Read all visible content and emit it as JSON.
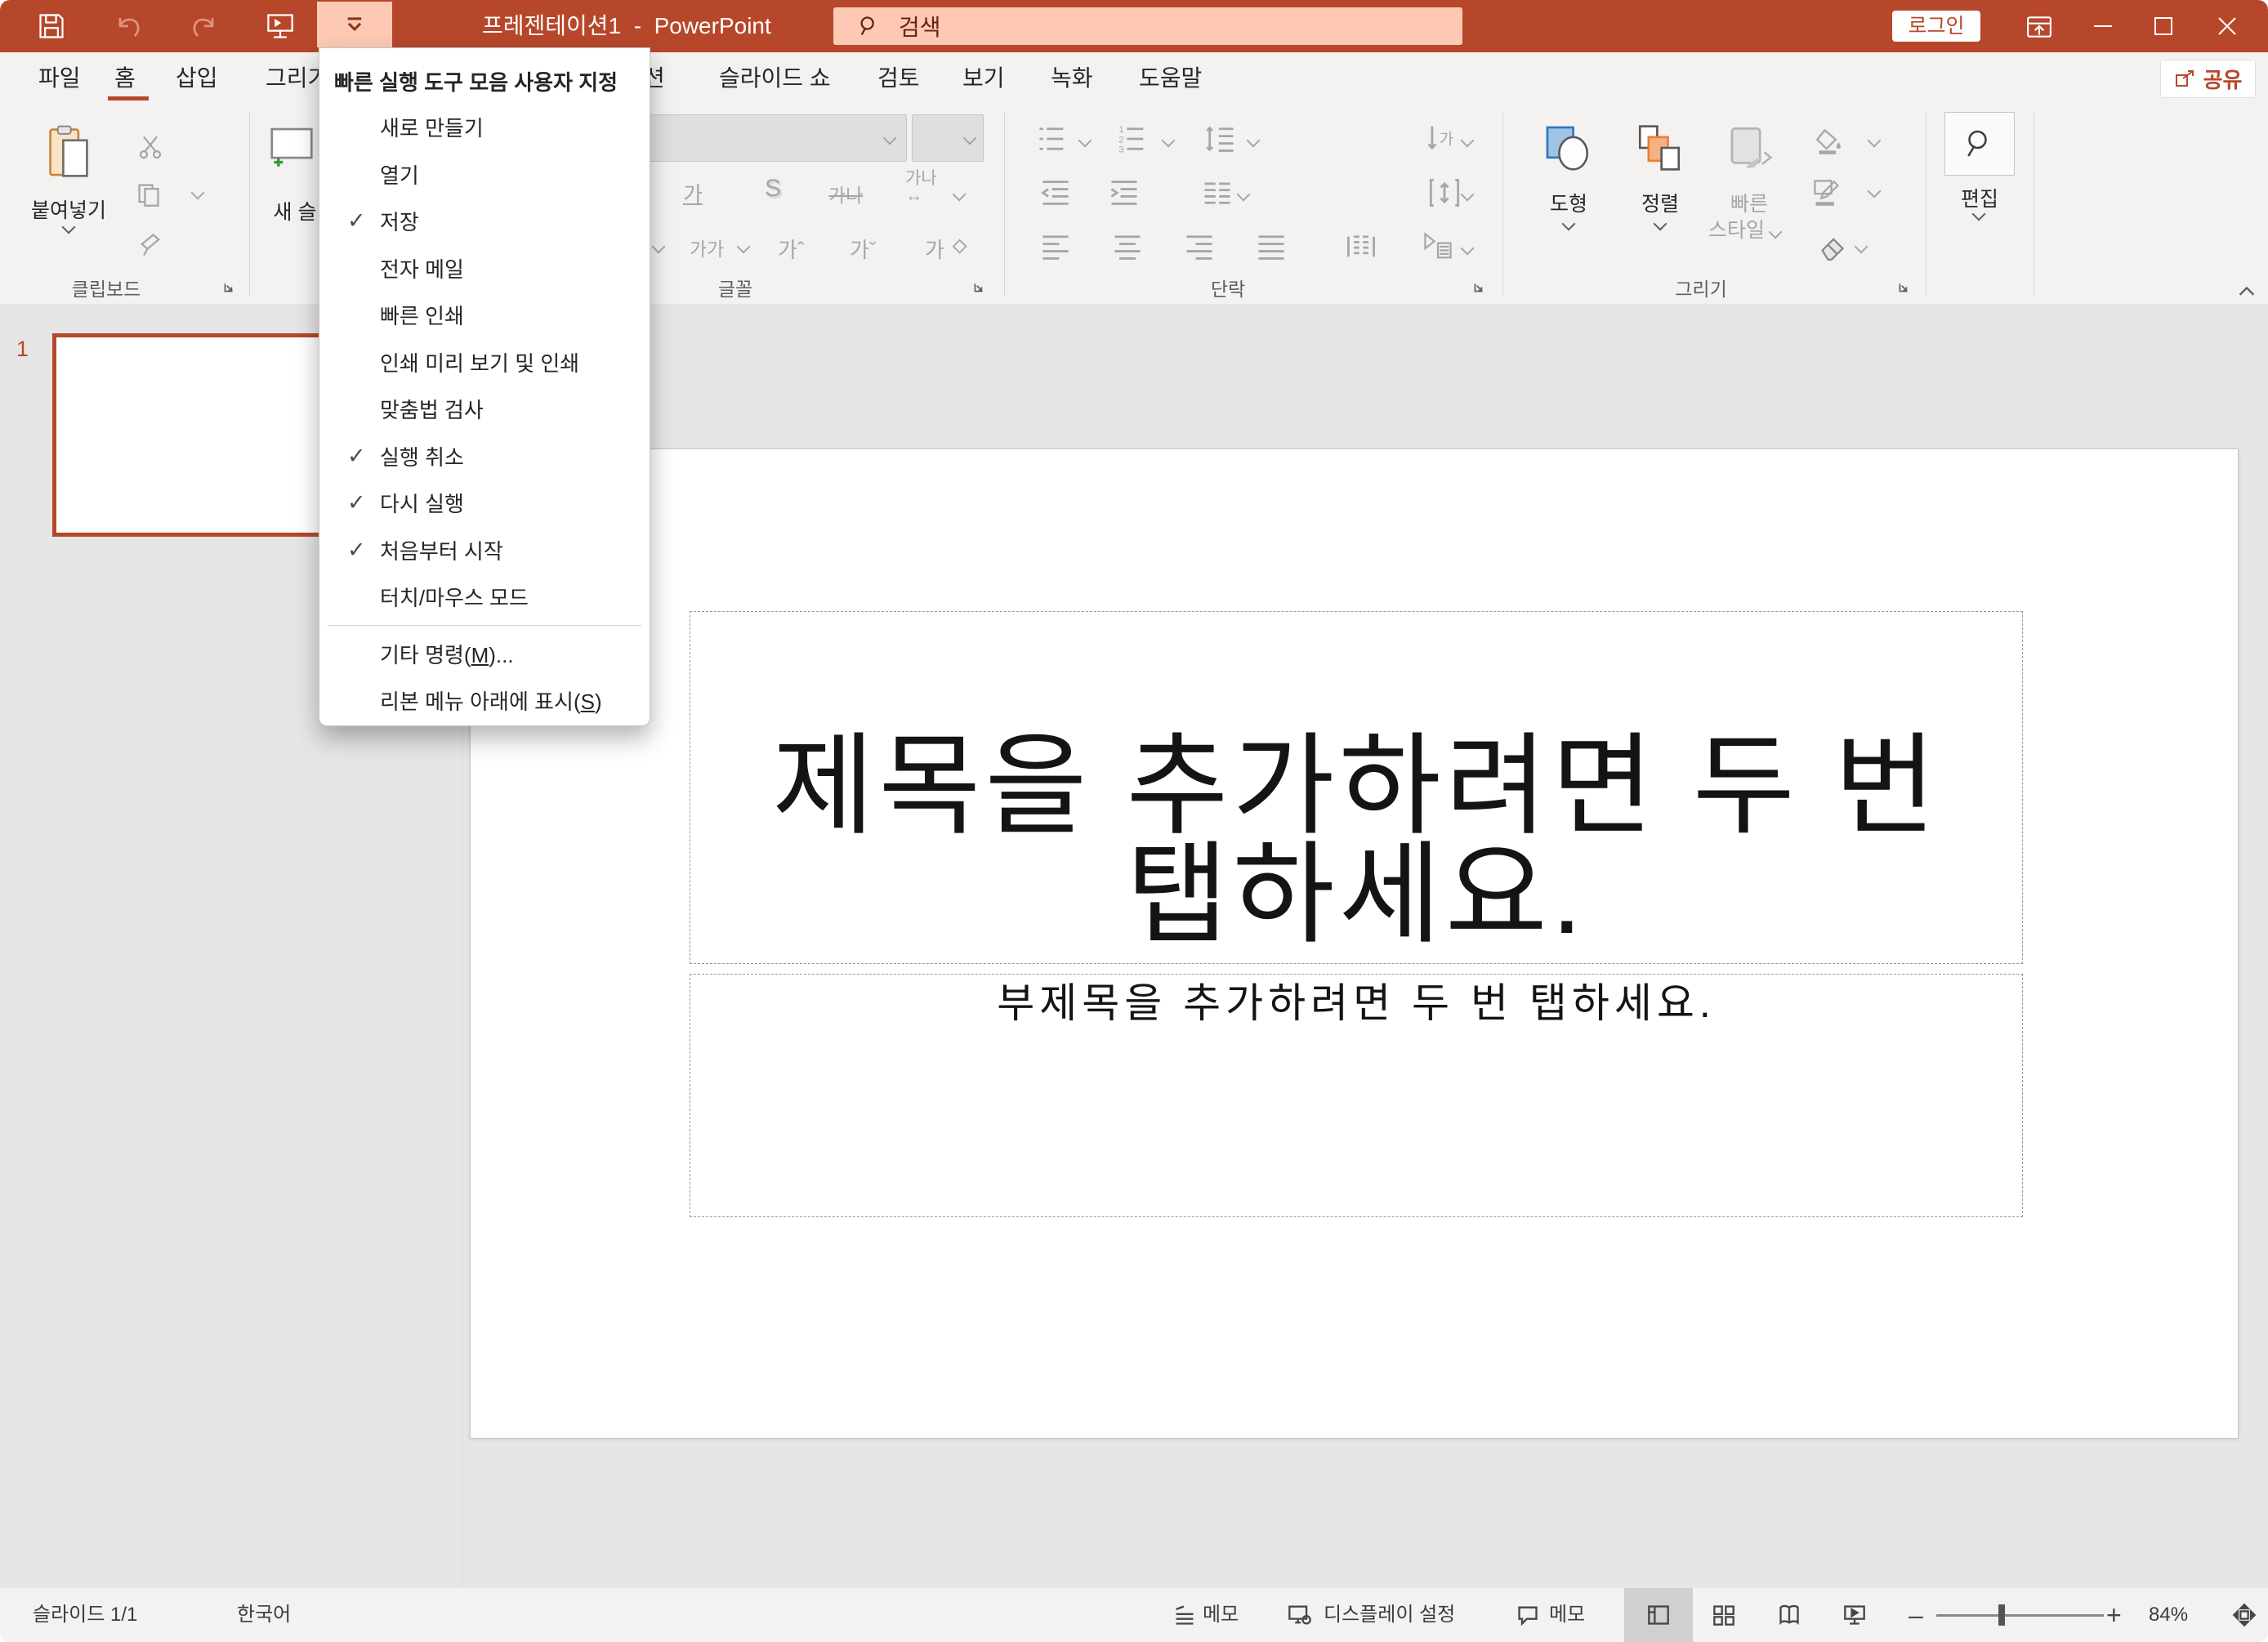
{
  "titlebar": {
    "title": "프레젠테이션1  -  PowerPoint",
    "search_placeholder": "검색",
    "login_label": "로그인"
  },
  "qat_menu": {
    "header": "빠른 실행 도구 모음 사용자 지정",
    "items": [
      {
        "label": "새로 만들기",
        "checked": false
      },
      {
        "label": "열기",
        "checked": false
      },
      {
        "label": "저장",
        "checked": true
      },
      {
        "label": "전자 메일",
        "checked": false
      },
      {
        "label": "빠른 인쇄",
        "checked": false
      },
      {
        "label": "인쇄 미리 보기 및 인쇄",
        "checked": false
      },
      {
        "label": "맞춤법 검사",
        "checked": false
      },
      {
        "label": "실행 취소",
        "checked": true
      },
      {
        "label": "다시 실행",
        "checked": true
      },
      {
        "label": "처음부터 시작",
        "checked": true
      },
      {
        "label": "터치/마우스 모드",
        "checked": false
      }
    ],
    "footer_items": [
      {
        "pre": "기타 명령(",
        "key": "M",
        "post": ")..."
      },
      {
        "pre": "리본 메뉴 아래에 표시(",
        "key": "S",
        "post": ")"
      }
    ]
  },
  "tabs": {
    "items": [
      {
        "label": "파일"
      },
      {
        "label": "홈"
      },
      {
        "label": "삽입"
      },
      {
        "label": "그리기"
      },
      {
        "label": "션"
      },
      {
        "label": "슬라이드 쇼"
      },
      {
        "label": "검토"
      },
      {
        "label": "보기"
      },
      {
        "label": "녹화"
      },
      {
        "label": "도움말"
      }
    ],
    "selected": "홈"
  },
  "ribbon": {
    "share_label": "공유",
    "paste_label": "붙여넣기",
    "new_slide_label": "새 슬",
    "clipboard_group": "클립보드",
    "font_group": "글꼴",
    "paragraph_group": "단락",
    "drawing_group": "그리기",
    "shapes_label": "도형",
    "arrange_label": "정렬",
    "quick_styles_line1": "빠른",
    "quick_styles_line2": "스타일",
    "edit_label": "편집",
    "font_buttons": {
      "underline": "가",
      "shadow": "S",
      "strike": "가나",
      "spacing_top": "가나",
      "spacing_bottom": "↔",
      "case": "가가",
      "grow": "가ˆ",
      "shrink": "가ˇ",
      "clear": "가"
    }
  },
  "slide_panel": {
    "slide_number": "1"
  },
  "slide": {
    "title_line1": "제목을 추가하려면 두 번",
    "title_line2": "탭하세요.",
    "subtitle_placeholder": "부제목을 추가하려면 두 번 탭하세요."
  },
  "statusbar": {
    "slide_indicator": "슬라이드 1/1",
    "language": "한국어",
    "notes_label": "메모",
    "display_settings_label": "디스플레이 설정",
    "comments_label": "메모",
    "zoom_percent": "84%"
  }
}
